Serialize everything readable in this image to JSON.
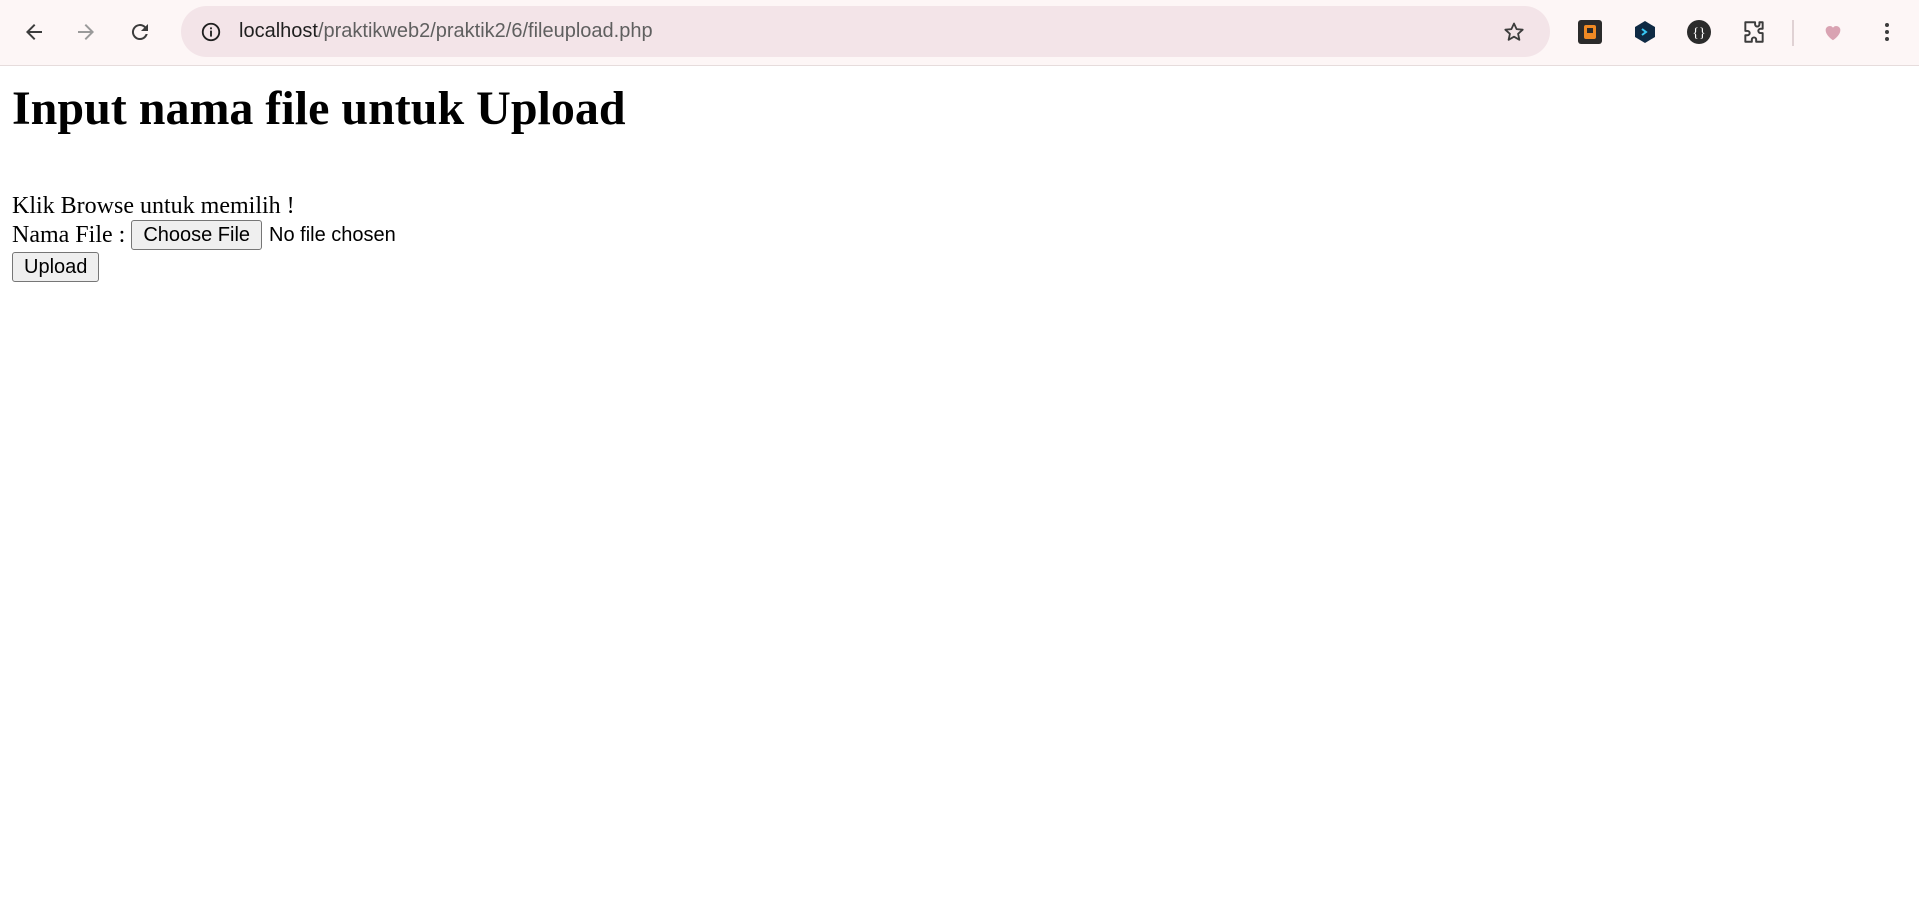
{
  "browser": {
    "url_host": "localhost",
    "url_path": "/praktikweb2/praktik2/6/fileupload.php",
    "icons": {
      "back": "arrow-left-icon",
      "forward": "arrow-right-icon",
      "reload": "reload-icon",
      "site_info": "info-icon",
      "bookmark": "star-icon",
      "extensions": "puzzle-icon",
      "menu": "kebab-menu-icon"
    }
  },
  "page": {
    "heading": "Input nama file untuk Upload",
    "instruction": "Klik Browse untuk memilih !",
    "file_label": "Nama File :",
    "choose_file_label": "Choose File",
    "file_status": "No file chosen",
    "upload_label": "Upload"
  }
}
